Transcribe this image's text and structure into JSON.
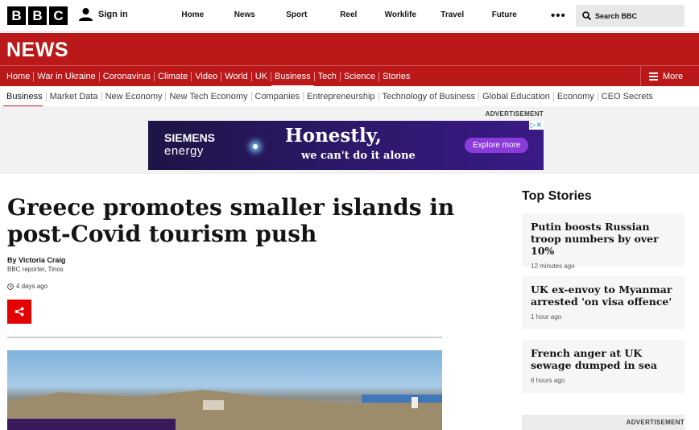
{
  "header": {
    "logo_letters": [
      "B",
      "B",
      "C"
    ],
    "signin_label": "Sign in",
    "nav": [
      "Home",
      "News",
      "Sport",
      "Reel",
      "Worklife",
      "Travel",
      "Future"
    ],
    "more_dots": "•••",
    "search_placeholder": "Search BBC"
  },
  "news": {
    "title": "NEWS",
    "sections": [
      "Home",
      "War in Ukraine",
      "Coronavirus",
      "Climate",
      "Video",
      "World",
      "UK",
      "Business",
      "Tech",
      "Science",
      "Stories"
    ],
    "active_section": "Business",
    "more_label": "More"
  },
  "business_nav": {
    "items": [
      "Business",
      "Market Data",
      "New Economy",
      "New Tech Economy",
      "Companies",
      "Entrepreneurship",
      "Technology of Business",
      "Global Education",
      "Economy",
      "CEO Secrets"
    ],
    "active": "Business"
  },
  "advert": {
    "label": "ADVERTISEMENT",
    "brand_line1": "SIEMENS",
    "brand_line2": "energy",
    "headline": "Honestly,",
    "subline": "we can't do it alone",
    "cta": "Explore more",
    "ad_choices": "▷✕"
  },
  "article": {
    "headline": "Greece promotes smaller islands in post-Covid tourism push",
    "byline": "By Victoria Craig",
    "role": "BBC reporter, Tinos",
    "timestamp": "4 days ago"
  },
  "top_stories": {
    "title": "Top Stories",
    "items": [
      {
        "headline": "Putin boosts Russian troop numbers by over 10%",
        "time": "12 minutes ago"
      },
      {
        "headline": "UK ex-envoy to Myanmar arrested 'on visa offence'",
        "time": "1 hour ago"
      },
      {
        "headline": "French anger at UK sewage dumped in sea",
        "time": "6 hours ago"
      }
    ],
    "ad_label": "ADVERTISEMENT"
  },
  "colors": {
    "bbc_red": "#bb1919",
    "share_red": "#e40000",
    "card_bg": "#f6f6f6"
  }
}
